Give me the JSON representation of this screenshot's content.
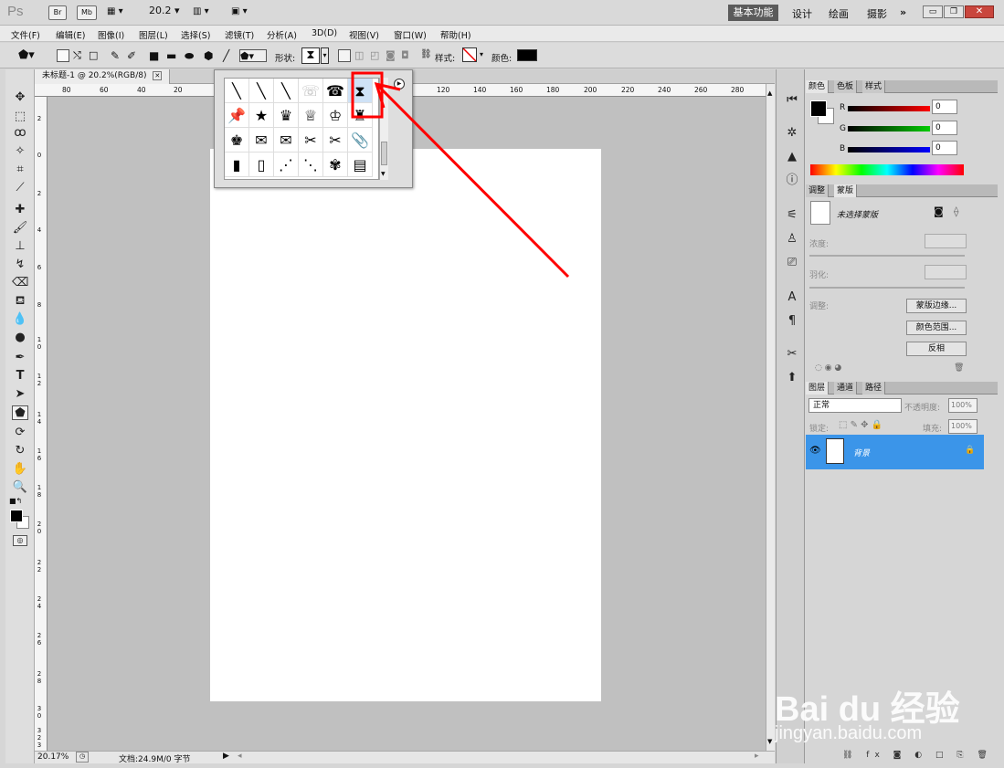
{
  "appbar": {
    "logo": "Ps",
    "bridge": "Br",
    "minibridge": "Mb",
    "zoom": "20.2",
    "workspace_active": "基本功能",
    "workspaces": [
      "设计",
      "绘画",
      "摄影"
    ],
    "more": "»"
  },
  "menu": [
    "文件(F)",
    "编辑(E)",
    "图像(I)",
    "图层(L)",
    "选择(S)",
    "滤镜(T)",
    "分析(A)",
    "3D(D)",
    "视图(V)",
    "窗口(W)",
    "帮助(H)"
  ],
  "options": {
    "shape_label": "形状:",
    "style_label": "样式:",
    "color_label": "颜色:",
    "color_value": "#000000"
  },
  "document": {
    "tab_title": "未标题-1 @ 20.2%(RGB/8)",
    "ruler_h": [
      "80",
      "60",
      "40",
      "20",
      "120",
      "140",
      "160",
      "180",
      "200",
      "220",
      "240",
      "260",
      "280"
    ],
    "ruler_v": [
      "2",
      "0",
      "2",
      "4",
      "6",
      "8",
      "1 0",
      "1 2",
      "1 4",
      "1 6",
      "1 8",
      "2 0",
      "2 2",
      "2 4",
      "2 6",
      "2 8",
      "3 0",
      "3 2",
      "3"
    ],
    "status_zoom": "20.17%",
    "status_doc": "文档:24.9M/0 字节"
  },
  "shape_picker": {
    "cells": [
      "╲",
      "╲",
      "╲",
      "☏",
      "☎",
      "⧗",
      "📌",
      "★",
      "♛",
      "♕",
      "♔",
      "♜",
      "♚",
      "✉",
      "✉",
      "✂",
      "✂",
      "📎",
      "▮",
      "▯",
      "⋰",
      "⋱",
      "✾",
      "▤"
    ]
  },
  "panels": {
    "color_tabs": [
      "颜色",
      "色板",
      "样式"
    ],
    "rgb": [
      {
        "label": "R",
        "value": "0"
      },
      {
        "label": "G",
        "value": "0"
      },
      {
        "label": "B",
        "value": "0"
      }
    ],
    "mask_tabs": [
      "调整",
      "蒙版"
    ],
    "mask_title": "未选择蒙版",
    "density_label": "浓度:",
    "feather_label": "羽化:",
    "adjust_label": "调整:",
    "mask_buttons": [
      "蒙版边缘...",
      "颜色范围...",
      "反相"
    ],
    "layer_tabs": [
      "图层",
      "通道",
      "路径"
    ],
    "blend_mode": "正常",
    "opacity_label": "不透明度:",
    "opacity_value": "100%",
    "lock_label": "锁定:",
    "fill_label": "填充:",
    "fill_value": "100%",
    "layer_name": "背景"
  },
  "watermark": {
    "brand": "Bai du 经验",
    "url": "jingyan.baidu.com"
  },
  "colors": {
    "highlight": "#ff0000",
    "layer_selected": "#3b95e9"
  }
}
